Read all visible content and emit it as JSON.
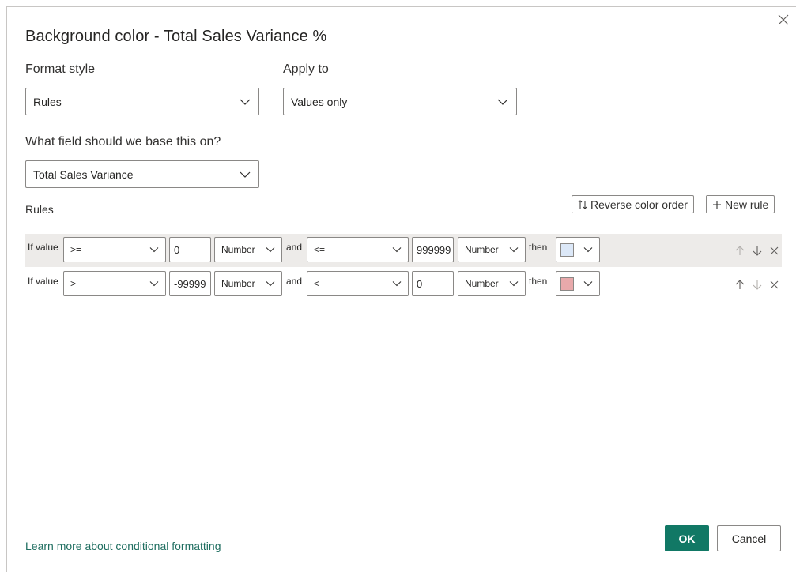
{
  "dialog": {
    "title": "Background color - Total Sales Variance %"
  },
  "format_style": {
    "label": "Format style",
    "value": "Rules"
  },
  "apply_to": {
    "label": "Apply to",
    "value": "Values only"
  },
  "base_field": {
    "label": "What field should we base this on?",
    "value": "Total Sales Variance"
  },
  "rules_section": {
    "label": "Rules",
    "reverse_color_order_label": "Reverse color order",
    "new_rule_label": "New rule"
  },
  "rules": [
    {
      "if_label": "If value",
      "op1": ">=",
      "val1": "0",
      "type1": "Number",
      "and_label": "and",
      "op2": "<=",
      "val2": "999999",
      "type2": "Number",
      "then_label": "then",
      "color": "#dce8f8"
    },
    {
      "if_label": "If value",
      "op1": ">",
      "val1": "-99999",
      "type1": "Number",
      "and_label": "and",
      "op2": "<",
      "val2": "0",
      "type2": "Number",
      "then_label": "then",
      "color": "#e8a9ab"
    }
  ],
  "footer": {
    "learn_more_link": "Learn more about conditional formatting",
    "ok_label": "OK",
    "cancel_label": "Cancel"
  },
  "colors": {
    "accent": "#117865",
    "link": "#1f6e60",
    "rule_row_highlight": "#edebe9"
  },
  "icons": {
    "close": "close-icon",
    "chevron": "chevron-down-icon",
    "reverse": "sort-arrows-icon",
    "add": "plus-icon",
    "move_up": "arrow-up-icon",
    "move_down": "arrow-down-icon",
    "delete": "close-icon"
  }
}
